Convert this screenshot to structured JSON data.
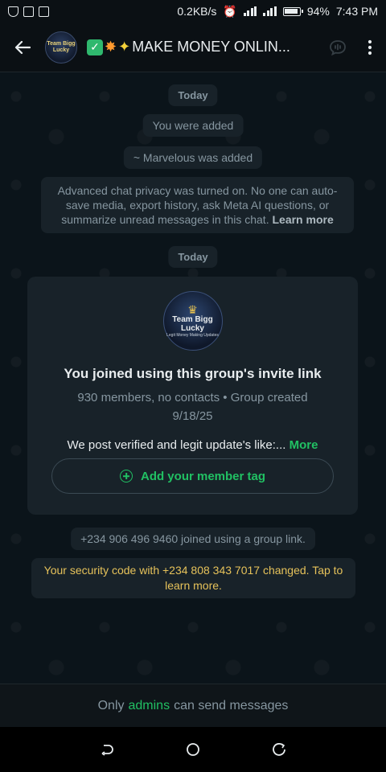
{
  "status_bar": {
    "speed": "0.2KB/s",
    "battery": "94%",
    "time": "7:43 PM"
  },
  "header": {
    "avatar_text": "Team Bigg Lucky",
    "title": "MAKE MONEY ONLIN...",
    "emojis": [
      "check-mark-emoji",
      "collision-emoji",
      "dizzy-emoji"
    ]
  },
  "chat": {
    "date_1": "Today",
    "system_1": "You were added",
    "system_2": "~ Marvelous was added",
    "privacy_text": "Advanced chat privacy was turned on. No one can auto-save media, export history, ask Meta AI questions, or summarize unread messages in this chat.",
    "privacy_link": "Learn more",
    "date_2": "Today",
    "card": {
      "avatar_brand": "Team Bigg Lucky",
      "avatar_sub": "Legit Money Making Updates",
      "heading": "You joined using this group's invite link",
      "meta": "930 members, no contacts • Group created 9/18/25",
      "desc": "We post verified and legit update's like:...",
      "more": "More",
      "tag_button": "Add your member tag"
    },
    "joined_text": "+234 906 496 9460 joined using a group link.",
    "security_text": "Your security code with +234 808 343 7017 changed. Tap to learn more."
  },
  "bottom": {
    "prefix": "Only",
    "admins": "admins",
    "suffix": "can send messages"
  },
  "colors": {
    "accent": "#21c063",
    "warning": "#e6c25a",
    "background": "#0b141a"
  }
}
